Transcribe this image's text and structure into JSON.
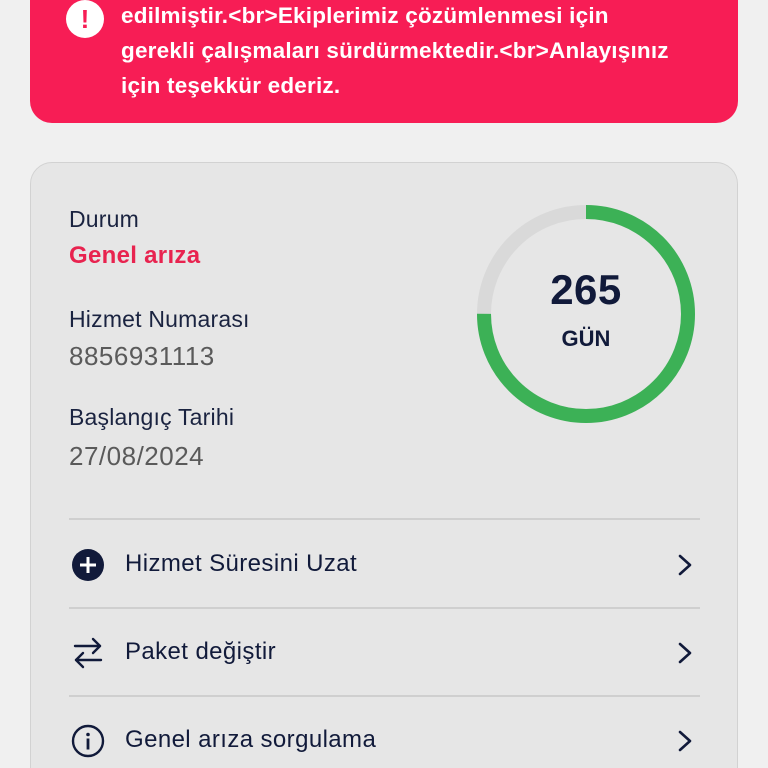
{
  "alert": {
    "icon": "exclamation-icon",
    "lines": [
      "edilmiştir.<br>Ekiplerimiz çözümlenmesi için",
      "gerekli çalışmaları sürdürmektedir.<br>Anlayışınız",
      "için teşekkür ederiz."
    ],
    "color": "#f71d55"
  },
  "status": {
    "label": "Durum",
    "value": "Genel arıza",
    "color": "#e8234f"
  },
  "service_number": {
    "label": "Hizmet Numarası",
    "value": "8856931113"
  },
  "start_date": {
    "label": "Başlangıç Tarihi",
    "value": "27/08/2024"
  },
  "remaining": {
    "number": "265",
    "unit": "GÜN",
    "progress": 0.75,
    "progress_color": "#3cb156",
    "track_color": "#d9d9d9"
  },
  "menu": [
    {
      "label": "Hizmet Süresini Uzat",
      "icon": "plus-circle-icon"
    },
    {
      "label": "Paket değiştir",
      "icon": "swap-arrows-icon"
    },
    {
      "label": "Genel arıza sorgulama",
      "icon": "info-circle-icon"
    }
  ]
}
